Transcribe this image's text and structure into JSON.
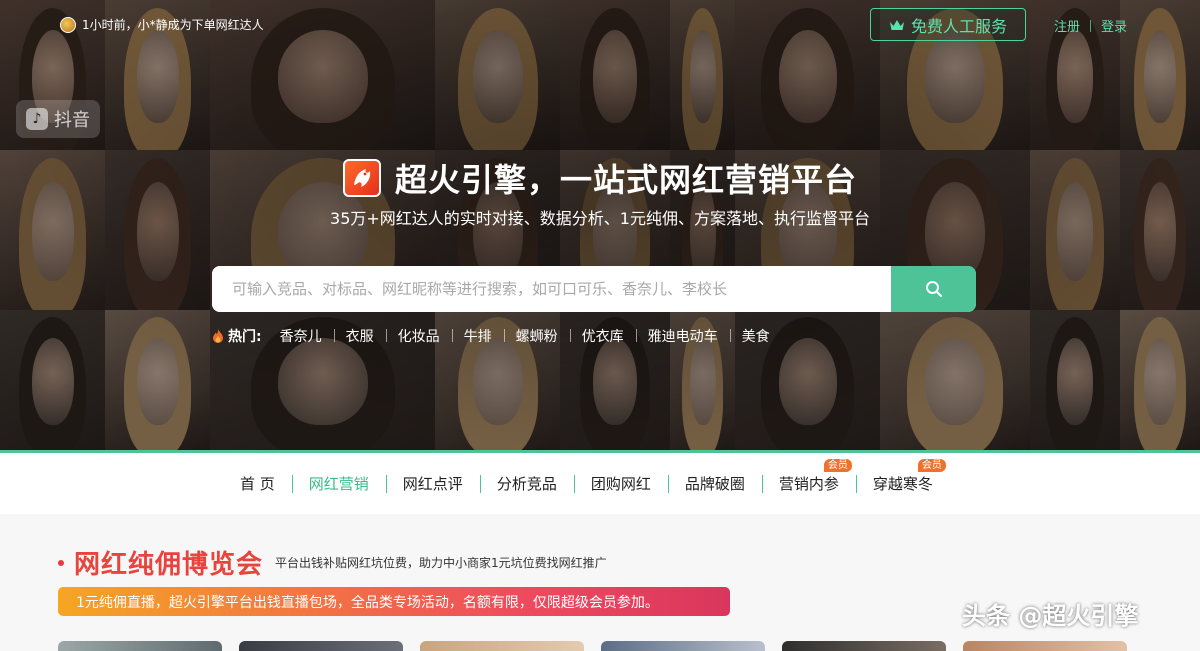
{
  "topbar": {
    "notice": "1小时前，小*静成为下单网红达人",
    "service_label": "免费人工服务",
    "register": "注册",
    "login": "登录"
  },
  "hero": {
    "title": "超火引擎，一站式网红营销平台",
    "subtitle": "35万+网红达人的实时对接、数据分析、1元纯佣、方案落地、执行监督平台",
    "search_placeholder": "可输入竞品、对标品、网红昵称等进行搜索，如可口可乐、香奈儿、李校长",
    "hot_label": "热门:",
    "hot_keywords": [
      "香奈儿",
      "衣服",
      "化妆品",
      "牛排",
      "螺蛳粉",
      "优衣库",
      "雅迪电动车",
      "美食"
    ],
    "platform_badges": [
      "抖音"
    ]
  },
  "nav": {
    "items": [
      {
        "label": "首 页",
        "badge": ""
      },
      {
        "label": "网红营销",
        "badge": ""
      },
      {
        "label": "网红点评",
        "badge": ""
      },
      {
        "label": "分析竞品",
        "badge": ""
      },
      {
        "label": "团购网红",
        "badge": ""
      },
      {
        "label": "品牌破圈",
        "badge": ""
      },
      {
        "label": "营销内参",
        "badge": "会员"
      },
      {
        "label": "穿越寒冬",
        "badge": "会员"
      }
    ],
    "active_index": 1
  },
  "expo": {
    "title": "网红纯佣博览会",
    "description": "平台出钱补贴网红坑位费，助力中小商家1元坑位费找网红推广",
    "promo": "1元纯佣直播，超火引擎平台出钱直播包场，全品类专场活动，名额有限，仅限超级会员参加。"
  },
  "watermark": "头条 @超火引擎",
  "colors": {
    "accent": "#4dc397",
    "expo_red": "#e8443d",
    "badge_orange": "#f0712b"
  },
  "icons": [
    "crown-icon",
    "search-icon",
    "fire-icon",
    "brand-logo-icon",
    "user-avatar"
  ]
}
